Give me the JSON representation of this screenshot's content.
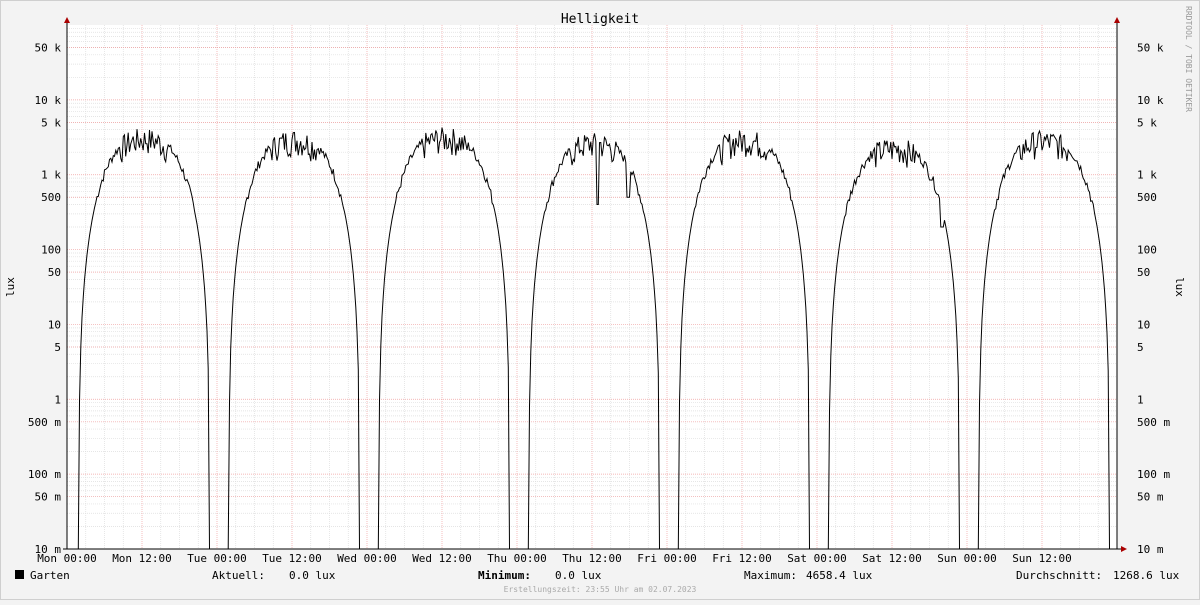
{
  "chart_data": {
    "type": "line",
    "title": "Helligkeit",
    "ylabel": "lux",
    "ylabel_right": "lux",
    "yscale": "log",
    "ylim": [
      0.01,
      100000
    ],
    "ytick_values": [
      0.01,
      0.05,
      0.1,
      0.5,
      1,
      5,
      10,
      50,
      100,
      500,
      1000,
      5000,
      10000,
      50000
    ],
    "ytick_labels": [
      "10 m",
      "50 m",
      "100 m",
      "500 m",
      "1",
      "5",
      "10",
      "50",
      "100",
      "500",
      "1 k",
      "5 k",
      "10 k",
      "50 k"
    ],
    "xunit": "hours",
    "xlim": [
      0,
      168
    ],
    "xtick_values": [
      0,
      12,
      24,
      36,
      48,
      60,
      72,
      84,
      96,
      108,
      120,
      132,
      144,
      156
    ],
    "xtick_labels": [
      "Mon 00:00",
      "Mon 12:00",
      "Tue 00:00",
      "Tue 12:00",
      "Wed 00:00",
      "Wed 12:00",
      "Thu 00:00",
      "Thu 12:00",
      "Fri 00:00",
      "Fri 12:00",
      "Sat 00:00",
      "Sat 12:00",
      "Sun 00:00",
      "Sun 12:00"
    ],
    "grid": true,
    "series": [
      {
        "name": "Garten",
        "color": "#000000",
        "days": [
          {
            "sunrise": 1.9,
            "sunset": 22.8,
            "peak": 3200,
            "dips": []
          },
          {
            "sunrise": 25.9,
            "sunset": 46.8,
            "peak": 3100,
            "dips": []
          },
          {
            "sunrise": 49.9,
            "sunset": 70.8,
            "peak": 3300,
            "dips": []
          },
          {
            "sunrise": 73.9,
            "sunset": 94.8,
            "peak": 2800,
            "dips": [
              [
                84.9,
                400
              ],
              [
                89.8,
                500
              ]
            ]
          },
          {
            "sunrise": 97.9,
            "sunset": 118.8,
            "peak": 3100,
            "dips": []
          },
          {
            "sunrise": 121.9,
            "sunset": 142.8,
            "peak": 2400,
            "dips": [
              [
                138.2,
                850
              ],
              [
                140.0,
                200
              ]
            ]
          },
          {
            "sunrise": 145.9,
            "sunset": 166.8,
            "peak": 3000,
            "dips": []
          }
        ]
      }
    ]
  },
  "legend": {
    "series_name": "Garten",
    "color": "#000000",
    "aktuell_label": "Aktuell:",
    "aktuell_value": "0.0 lux",
    "minimum_label": "Minimum:",
    "minimum_value": "0.0 lux",
    "maximum_label": "Maximum:",
    "maximum_value": "4658.4 lux",
    "average_label": "Durchschnitt:",
    "average_value": "1268.6 lux"
  },
  "footer": "Erstellungszeit: 23:55 Uhr am 02.07.2023",
  "watermark": "RRDTOOL / TOBI OETIKER",
  "colors": {
    "background": "#f3f3f3",
    "canvas": "#ffffff",
    "grid_major": "#f0a0a0",
    "grid_minor": "#dddddd",
    "arrow": "#aa0000"
  }
}
